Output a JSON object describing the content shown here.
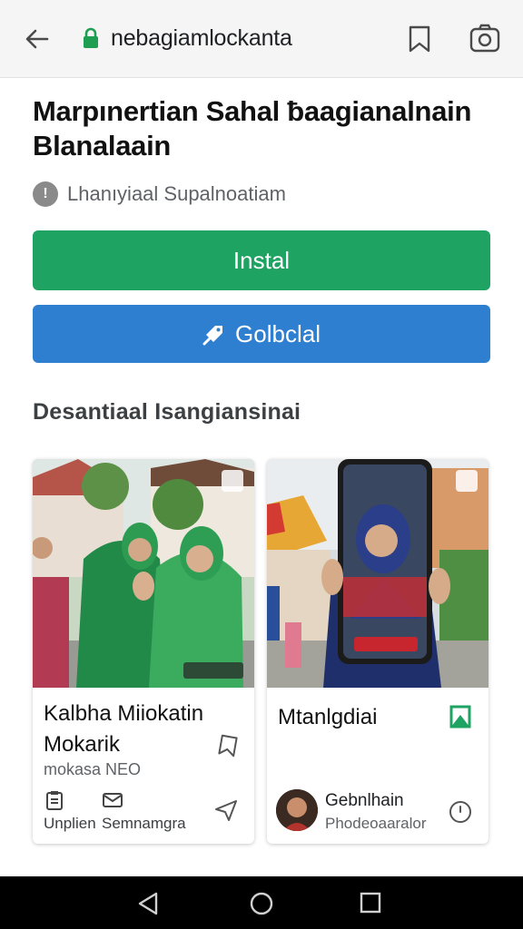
{
  "browser": {
    "url": "nebagiamlockanta"
  },
  "article": {
    "title": "Marpınertian Sahal ƀaagianalnain Blanalaain",
    "meta": "Lhanıyiaal Supalnoatiam",
    "info_icon_glyph": "!"
  },
  "buttons": {
    "install": "Instal",
    "download": "Golbclal"
  },
  "section": {
    "heading": "Desantiaal Isangiansinai"
  },
  "cards": [
    {
      "title": "Kalbha Miiokatin Mokarik",
      "subtitle": "mokasa NEO",
      "actions": [
        {
          "icon": "clipboard-icon",
          "label": "Unplien"
        },
        {
          "icon": "message-icon",
          "label": "Semnamgra"
        }
      ],
      "share_icon": "share-icon"
    },
    {
      "title": "Mtanlgdiai",
      "flag_icon": "green-flag-icon",
      "author": {
        "name": "Gebnlhain",
        "role": "Phodeoaaralor"
      },
      "clock_icon": "clock-icon"
    }
  ],
  "colors": {
    "install": "#1ea362",
    "download": "#2f7fd0",
    "lock": "#1e9e50",
    "flag": "#1ea362"
  }
}
